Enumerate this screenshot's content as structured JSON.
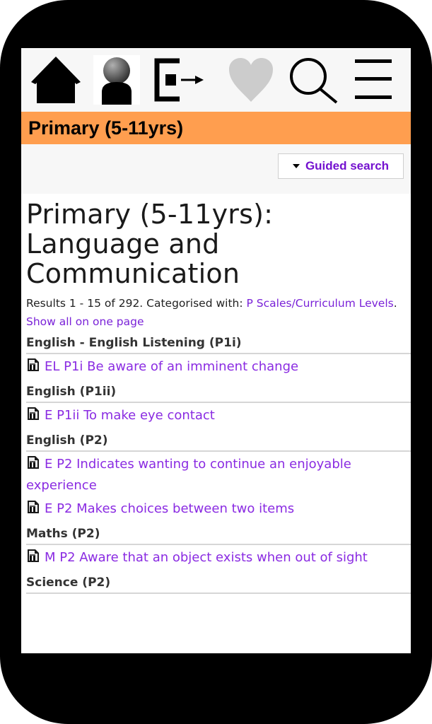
{
  "nav": {
    "icons": [
      "home-icon",
      "profile-icon",
      "logout-icon",
      "favourites-icon",
      "search-icon",
      "menu-icon"
    ]
  },
  "banner": {
    "title": "Primary (5-11yrs)"
  },
  "toolbar": {
    "guided_search_label": "Guided search"
  },
  "main": {
    "title": "Primary (5-11yrs): Language and Communication",
    "results_prefix": "Results 1 - 15 of 292. Categorised with: ",
    "category_link": "P Scales/Curriculum Levels",
    "separator": ". ",
    "show_all_link": "Show all on one page"
  },
  "groups": [
    {
      "heading": "English - English Listening (P1i)",
      "items": [
        "EL P1i Be aware of an imminent change"
      ]
    },
    {
      "heading": "English (P1ii)",
      "items": [
        "E P1ii To make eye contact"
      ]
    },
    {
      "heading": "English (P2)",
      "items": [
        "E P2 Indicates wanting to continue an enjoyable experience",
        "E P2 Makes choices between two items"
      ]
    },
    {
      "heading": "Maths (P2)",
      "items": [
        "M P2 Aware that an object exists when out of sight"
      ]
    },
    {
      "heading": "Science (P2)",
      "items": []
    }
  ],
  "colors": {
    "banner": "#ff9e4f",
    "link": "#8a2be2",
    "accent": "#7412cf"
  }
}
